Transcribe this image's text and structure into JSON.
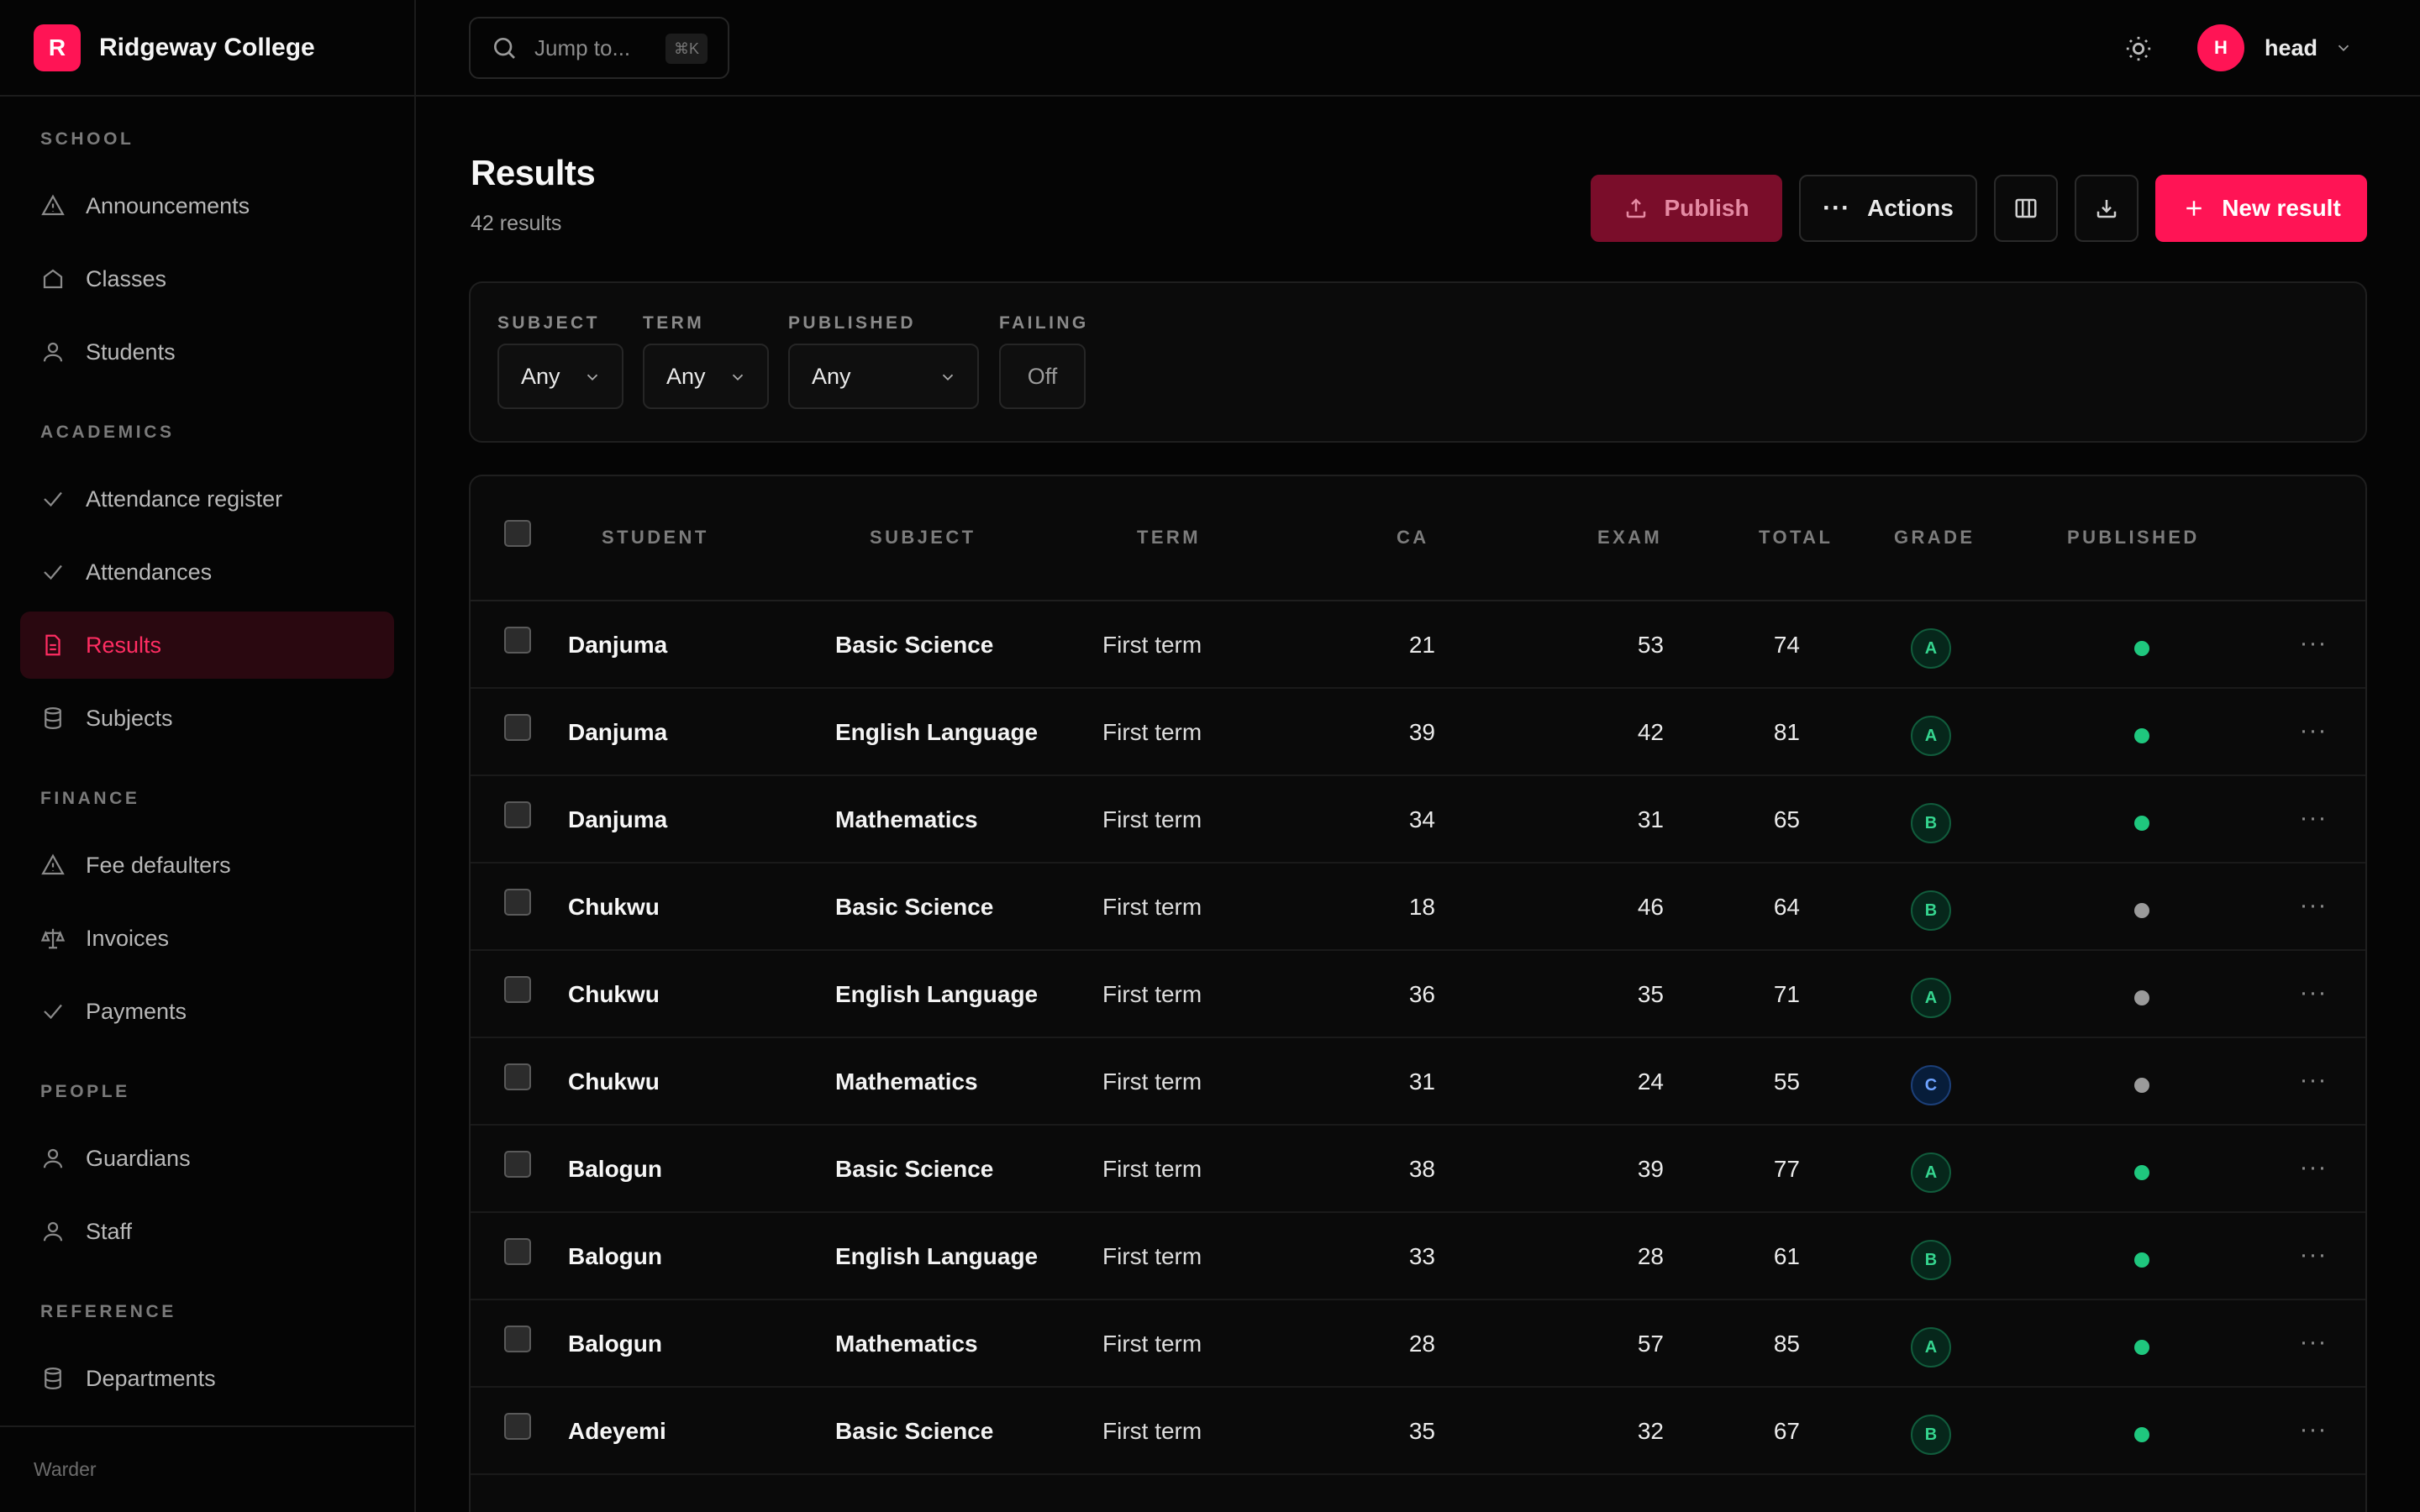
{
  "app": {
    "logo_letter": "R",
    "name": "Ridgeway College",
    "footer": "Warder",
    "accent": "#ff1455"
  },
  "sidebar": {
    "sections": [
      {
        "label": "SCHOOL",
        "items": [
          {
            "label": "Announcements",
            "icon": "alert-triangle-icon"
          },
          {
            "label": "Classes",
            "icon": "home-icon"
          },
          {
            "label": "Students",
            "icon": "user-icon"
          }
        ]
      },
      {
        "label": "ACADEMICS",
        "items": [
          {
            "label": "Attendance register",
            "icon": "check-icon"
          },
          {
            "label": "Attendances",
            "icon": "check-icon"
          },
          {
            "label": "Results",
            "icon": "file-text-icon",
            "active": true
          },
          {
            "label": "Subjects",
            "icon": "database-icon"
          }
        ]
      },
      {
        "label": "FINANCE",
        "items": [
          {
            "label": "Fee defaulters",
            "icon": "alert-triangle-icon"
          },
          {
            "label": "Invoices",
            "icon": "scale-icon"
          },
          {
            "label": "Payments",
            "icon": "check-icon"
          }
        ]
      },
      {
        "label": "PEOPLE",
        "items": [
          {
            "label": "Guardians",
            "icon": "user-icon"
          },
          {
            "label": "Staff",
            "icon": "user-icon"
          }
        ]
      },
      {
        "label": "REFERENCE",
        "items": [
          {
            "label": "Departments",
            "icon": "database-icon"
          }
        ]
      }
    ]
  },
  "topbar": {
    "search_placeholder": "Jump to...",
    "search_shortcut": "⌘K",
    "theme_icon": "sun-icon",
    "user_initial": "H",
    "user_name": "head"
  },
  "page": {
    "title": "Results",
    "count": "42 results"
  },
  "toolbar": {
    "publish_label": "Publish",
    "actions_label": "Actions",
    "columns_icon": "columns-icon",
    "download_icon": "download-icon",
    "new_label": "New result"
  },
  "filters": {
    "subject": {
      "label": "SUBJECT",
      "value": "Any"
    },
    "term": {
      "label": "TERM",
      "value": "Any"
    },
    "published": {
      "label": "PUBLISHED",
      "value": "Any"
    },
    "failing": {
      "label": "FAILING",
      "value": "Off"
    }
  },
  "table": {
    "headers": {
      "student": "STUDENT",
      "subject": "SUBJECT",
      "term": "TERM",
      "ca": "CA",
      "exam": "EXAM",
      "total": "TOTAL",
      "grade": "GRADE",
      "published": "PUBLISHED"
    },
    "status_colors": {
      "published": "#1fc77e",
      "unpublished": "#9a9a9a"
    },
    "rows": [
      {
        "student": "Danjuma",
        "subject": "Basic Science",
        "term": "First term",
        "ca": "21",
        "exam": "53",
        "total": "74",
        "grade": "A",
        "published": true
      },
      {
        "student": "Danjuma",
        "subject": "English Language",
        "term": "First term",
        "ca": "39",
        "exam": "42",
        "total": "81",
        "grade": "A",
        "published": true
      },
      {
        "student": "Danjuma",
        "subject": "Mathematics",
        "term": "First term",
        "ca": "34",
        "exam": "31",
        "total": "65",
        "grade": "B",
        "published": true
      },
      {
        "student": "Chukwu",
        "subject": "Basic Science",
        "term": "First term",
        "ca": "18",
        "exam": "46",
        "total": "64",
        "grade": "B",
        "published": false
      },
      {
        "student": "Chukwu",
        "subject": "English Language",
        "term": "First term",
        "ca": "36",
        "exam": "35",
        "total": "71",
        "grade": "A",
        "published": false
      },
      {
        "student": "Chukwu",
        "subject": "Mathematics",
        "term": "First term",
        "ca": "31",
        "exam": "24",
        "total": "55",
        "grade": "C",
        "published": false
      },
      {
        "student": "Balogun",
        "subject": "Basic Science",
        "term": "First term",
        "ca": "38",
        "exam": "39",
        "total": "77",
        "grade": "A",
        "published": true
      },
      {
        "student": "Balogun",
        "subject": "English Language",
        "term": "First term",
        "ca": "33",
        "exam": "28",
        "total": "61",
        "grade": "B",
        "published": true
      },
      {
        "student": "Balogun",
        "subject": "Mathematics",
        "term": "First term",
        "ca": "28",
        "exam": "57",
        "total": "85",
        "grade": "A",
        "published": true
      },
      {
        "student": "Adeyemi",
        "subject": "Basic Science",
        "term": "First term",
        "ca": "35",
        "exam": "32",
        "total": "67",
        "grade": "B",
        "published": true
      }
    ]
  }
}
